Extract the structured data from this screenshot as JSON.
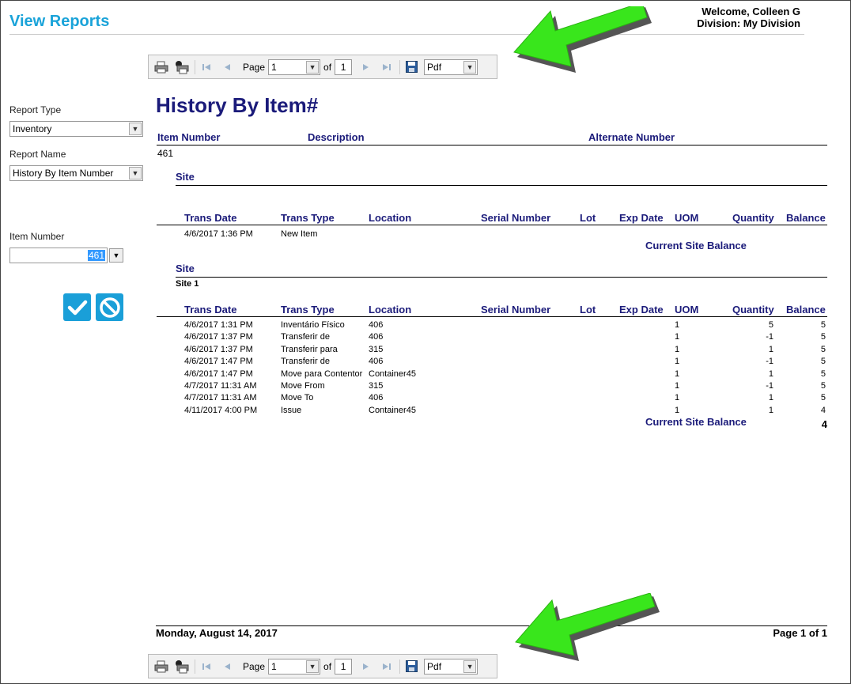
{
  "header": {
    "title": "View Reports",
    "welcome": "Welcome, Colleen G",
    "division": "Division: My Division"
  },
  "toolbar": {
    "page_label": "Page",
    "page_value": "1",
    "of_label": "of",
    "total_pages": "1",
    "format_value": "Pdf"
  },
  "left_panel": {
    "report_type_label": "Report Type",
    "report_type_value": "Inventory",
    "report_name_label": "Report Name",
    "report_name_value": "History By Item Number",
    "item_number_label": "Item Number",
    "item_number_value": "461"
  },
  "report": {
    "title": "History By Item#",
    "item_headers": [
      "Item Number",
      "Description",
      "Alternate Number"
    ],
    "item_number": "461",
    "site_label": "Site",
    "columns": [
      "Trans Date",
      "Trans Type",
      "Location",
      "Serial Number",
      "Lot",
      "Exp Date",
      "UOM",
      "Quantity",
      "Balance"
    ],
    "section1": {
      "rows": [
        {
          "date": "4/6/2017 1:36 PM",
          "type": "New Item",
          "location": "",
          "uom": "",
          "qty": "",
          "balance": ""
        }
      ],
      "balance_label": "Current Site Balance",
      "balance_value": ""
    },
    "section2": {
      "site_name": "Site 1",
      "rows": [
        {
          "date": "4/6/2017 1:31 PM",
          "type": "Inventário Físico",
          "location": "406",
          "uom": "1",
          "qty": "5",
          "balance": "5"
        },
        {
          "date": "4/6/2017 1:37 PM",
          "type": "Transferir de",
          "location": "406",
          "uom": "1",
          "qty": "-1",
          "balance": "5"
        },
        {
          "date": "4/6/2017 1:37 PM",
          "type": "Transferir para",
          "location": "315",
          "uom": "1",
          "qty": "1",
          "balance": "5"
        },
        {
          "date": "4/6/2017 1:47 PM",
          "type": "Transferir de",
          "location": "406",
          "uom": "1",
          "qty": "-1",
          "balance": "5"
        },
        {
          "date": "4/6/2017 1:47 PM",
          "type": "Move para Contentor",
          "location": "Container45",
          "uom": "1",
          "qty": "1",
          "balance": "5"
        },
        {
          "date": "4/7/2017 11:31 AM",
          "type": "Move From",
          "location": "315",
          "uom": "1",
          "qty": "-1",
          "balance": "5"
        },
        {
          "date": "4/7/2017 11:31 AM",
          "type": "Move To",
          "location": "406",
          "uom": "1",
          "qty": "1",
          "balance": "5"
        },
        {
          "date": "4/11/2017 4:00 PM",
          "type": "Issue",
          "location": "Container45",
          "uom": "1",
          "qty": "1",
          "balance": "4"
        }
      ],
      "balance_label": "Current Site Balance",
      "balance_value": "4"
    },
    "footer_date": "Monday, August 14, 2017",
    "footer_page": "Page 1 of 1"
  },
  "colors": {
    "title_blue": "#1aa3d9",
    "report_navy": "#1b1b7a",
    "arrow_green": "#39e61c",
    "button_blue": "#1a9fd8"
  }
}
